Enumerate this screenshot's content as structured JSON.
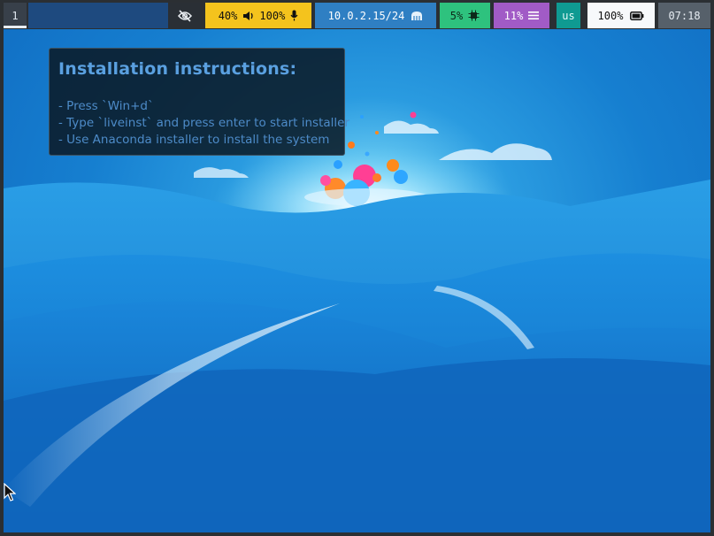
{
  "statusbar": {
    "workspace": "1",
    "window_title": "",
    "privacy_icon": "eye-slash-icon",
    "audio": {
      "volume": "40%",
      "speaker_icon": "speaker-icon",
      "mic_level": "100%",
      "mic_icon": "microphone-icon"
    },
    "network": {
      "address": "10.0.2.15/24",
      "icon": "ethernet-icon"
    },
    "cpu": {
      "usage": "5%",
      "icon": "cpu-chip-icon"
    },
    "memory": {
      "usage": "11%",
      "icon": "memory-bars-icon"
    },
    "keyboard_layout": "us",
    "battery": {
      "level": "100%",
      "icon": "battery-icon"
    },
    "clock": "07:18"
  },
  "notice": {
    "title": "Installation instructions:",
    "lines": [
      "- Press `Win+d`",
      "- Type `liveinst` and press enter to start installer",
      "- Use Anaconda installer to install the system"
    ]
  },
  "colors": {
    "bar_bg": "#2b2f33",
    "audio_bg": "#f4c31d",
    "network_bg": "#2f7fc3",
    "cpu_bg": "#2ec27e",
    "memory_bg": "#a15bc6",
    "keyboard_bg": "#0f9a92",
    "battery_bg": "#f7f9fb",
    "clock_bg": "#56606a"
  }
}
